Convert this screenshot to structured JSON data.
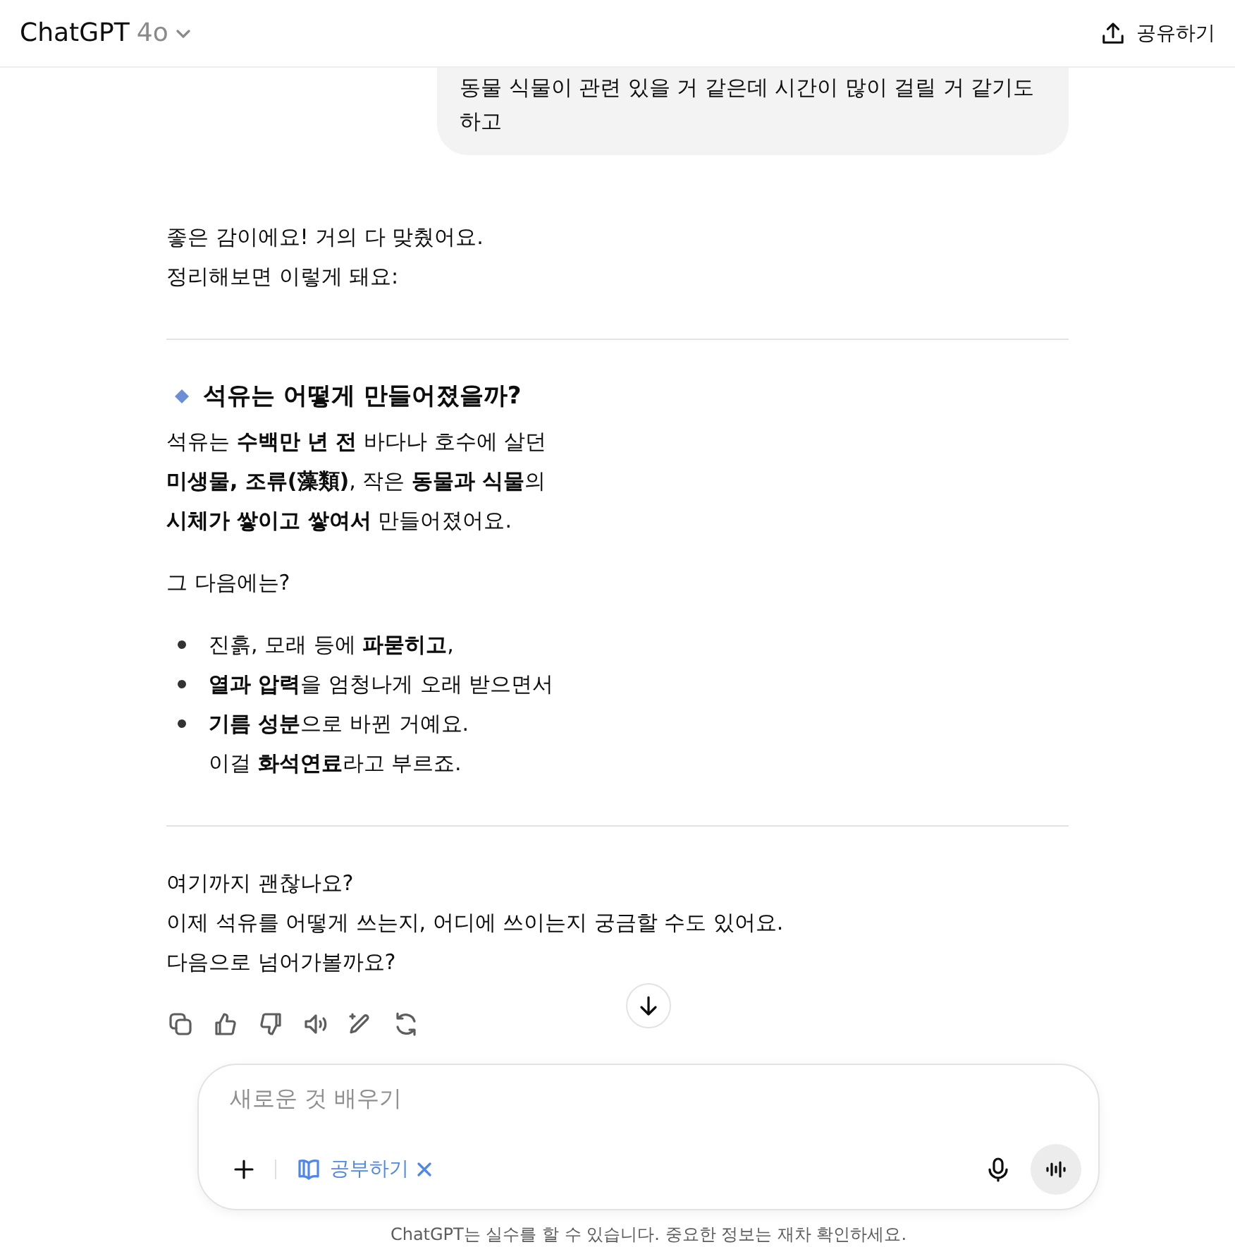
{
  "header": {
    "model_name": "ChatGPT",
    "model_version": "4o",
    "share_label": "공유하기"
  },
  "user_message": {
    "text": "동물 식물이 관련 있을 거 같은데 시간이 많이 걸릴 거 같기도하고"
  },
  "assistant_blocks": [
    {
      "kind": "paragraph",
      "lines": [
        "좋은 감이에요! 거의 다 맞췄어요.",
        "정리해보면 이렇게 돼요:"
      ]
    },
    {
      "kind": "divider"
    },
    {
      "kind": "heading",
      "text": "석유는 어떻게 만들어졌을까?"
    },
    {
      "kind": "paragraph",
      "lines": [
        "석유는 **수백만 년 전** 바다나 호수에 살던",
        "**미생물, 조류(藻類)**, 작은 **동물과 식물**의",
        "**시체가 쌓이고 쌓여서** 만들어졌어요."
      ]
    },
    {
      "kind": "paragraph",
      "lines": [
        "그 다음에는?"
      ]
    },
    {
      "kind": "list",
      "items": [
        {
          "lines": [
            "진흙, 모래 등에 **파묻히고**,"
          ]
        },
        {
          "lines": [
            "**열과 압력**을 엄청나게 오래 받으면서"
          ]
        },
        {
          "lines": [
            "**기름 성분**으로 바뀐 거예요.",
            "이걸 **화석연료**라고 부르죠."
          ]
        }
      ]
    },
    {
      "kind": "divider"
    },
    {
      "kind": "paragraph",
      "lines": [
        "여기까지 괜찮나요?",
        "이제 석유를 어떻게 쓰는지, 어디에 쓰이는지 궁금할 수도 있어요.",
        "다음으로 넘어가볼까요?"
      ]
    }
  ],
  "composer": {
    "placeholder": "새로운 것 배우기",
    "tool_chip": {
      "label": "공부하기",
      "active": true
    }
  },
  "footer": "ChatGPT는 실수를 할 수 있습니다. 중요한 정보는 재차 확인하세요."
}
